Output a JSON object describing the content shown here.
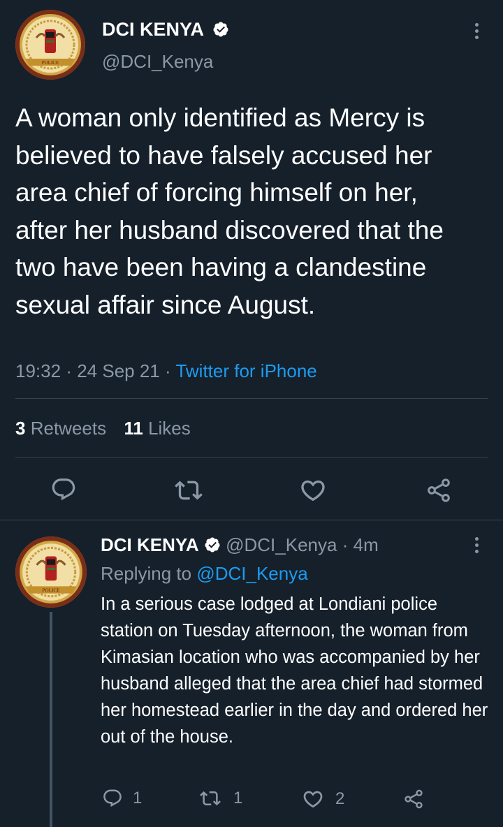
{
  "main_tweet": {
    "author_name": "DCI KENYA",
    "author_handle": "@DCI_Kenya",
    "avatar_text": "POLICE",
    "text": "A woman only identified as Mercy is believed to have falsely accused her area chief of forcing himself on her, after her husband discovered that the two have been having a clandestine sexual affair since August.",
    "time": "19:32",
    "date": "24 Sep 21",
    "separator": "·",
    "source": "Twitter for iPhone",
    "retweets_count": "3",
    "retweets_label": "Retweets",
    "likes_count": "11",
    "likes_label": "Likes"
  },
  "reply_tweet": {
    "author_name": "DCI KENYA",
    "author_handle": "@DCI_Kenya",
    "separator": "·",
    "time_ago": "4m",
    "replying_label": "Replying to",
    "replying_to": "@DCI_Kenya",
    "text": "In a serious case lodged at Londiani police station on Tuesday afternoon, the woman from Kimasian location who was accompanied by her husband alleged that the area chief had stormed her homestead earlier in the day and ordered her out of the house.",
    "reply_count": "1",
    "retweet_count": "1",
    "like_count": "2"
  },
  "icons": {
    "verified": "verified-badge-icon",
    "more": "more-options-icon",
    "reply": "reply-icon",
    "retweet": "retweet-icon",
    "like": "heart-icon",
    "share": "share-icon"
  },
  "colors": {
    "background": "#15202b",
    "text": "#ffffff",
    "secondary": "#8b98a5",
    "link": "#1d9bf0",
    "divider": "#38444d",
    "thread_line": "#425364"
  }
}
